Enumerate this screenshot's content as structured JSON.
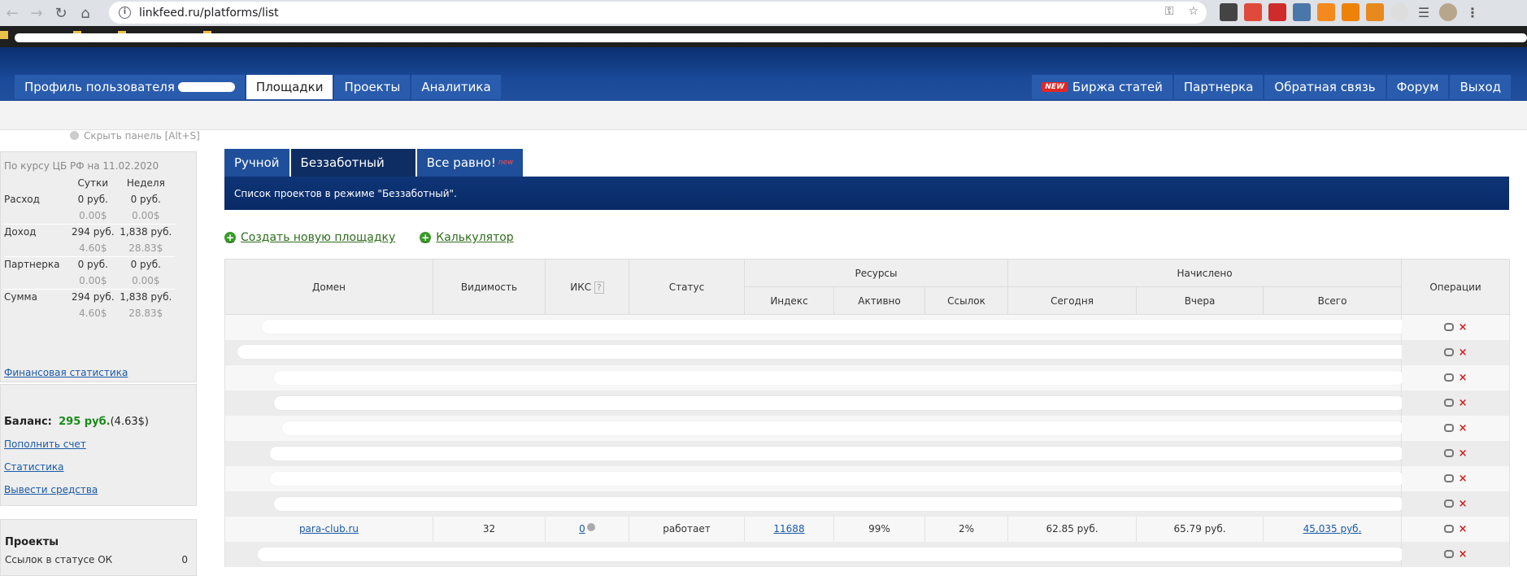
{
  "browser": {
    "url": "linkfeed.ru/platforms/list"
  },
  "header": {
    "left_menu": [
      {
        "label": "Профиль пользователя",
        "active": false
      },
      {
        "label": "Площадки",
        "active": true
      },
      {
        "label": "Проекты",
        "active": false
      },
      {
        "label": "Аналитика",
        "active": false
      }
    ],
    "right_menu": [
      {
        "label": "Биржа статей",
        "badge": "NEW"
      },
      {
        "label": "Партнерка"
      },
      {
        "label": "Обратная связь"
      },
      {
        "label": "Форум"
      },
      {
        "label": "Выход"
      }
    ]
  },
  "sidebar": {
    "hide_panel": "Скрыть панель [Alt+S]",
    "rate_note": "По курсу ЦБ РФ на 11.02.2020",
    "col_day": "Сутки",
    "col_week": "Неделя",
    "rows": [
      {
        "label": "Расход",
        "day": "0 руб.",
        "week": "0 руб.",
        "day_usd": "0.00$",
        "week_usd": "0.00$"
      },
      {
        "label": "Доход",
        "day": "294 руб.",
        "week": "1,838 руб.",
        "day_usd": "4.60$",
        "week_usd": "28.83$"
      },
      {
        "label": "Партнерка",
        "day": "0 руб.",
        "week": "0 руб.",
        "day_usd": "0.00$",
        "week_usd": "0.00$"
      },
      {
        "label": "Сумма",
        "day": "294 руб.",
        "week": "1,838 руб.",
        "day_usd": "4.60$",
        "week_usd": "28.83$"
      }
    ],
    "fin_stats_link": "Финансовая статистика",
    "balance_label": "Баланс:",
    "balance_rub": "295 руб.",
    "balance_usd": "(4.63$)",
    "links": [
      "Пополнить счет",
      "Статистика",
      "Вывести средства"
    ],
    "projects_title": "Проекты",
    "projects_row_label": "Ссылок в статусе ОК",
    "projects_row_value": "0"
  },
  "main": {
    "tabs": [
      {
        "label": "Ручной",
        "active": false
      },
      {
        "label": "Беззаботный",
        "active": true
      },
      {
        "label": "Все равно!",
        "sup": "new",
        "active": false
      }
    ],
    "banner": "Список проектов в режиме \"Беззаботный\".",
    "actions": [
      "Создать новую площадку",
      "Калькулятор"
    ],
    "table": {
      "headers": {
        "domain": "Домен",
        "visibility": "Видимость",
        "iks": "ИКС",
        "iks_help": "?",
        "status": "Статус",
        "resources": "Ресурсы",
        "index": "Индекс",
        "active": "Активно",
        "links": "Ссылок",
        "accrued": "Начислено",
        "today": "Сегодня",
        "yesterday": "Вчера",
        "total": "Всего",
        "operations": "Операции"
      },
      "visible_row": {
        "domain": "para-club.ru",
        "visibility": "32",
        "iks": "0",
        "status": "работает",
        "index": "11688",
        "active": "99%",
        "links": "2%",
        "today": "62.85 руб.",
        "yesterday": "65.79 руб.",
        "total": "45,035 руб."
      }
    }
  }
}
